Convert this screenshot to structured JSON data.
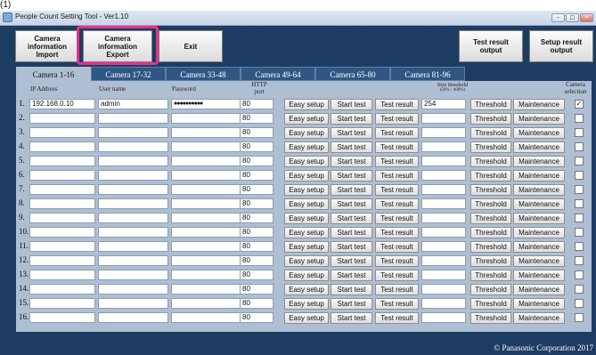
{
  "figure_label": "(1)",
  "window": {
    "title": "People Count Setting Tool - Ver1.10",
    "controls": {
      "minimize": "–",
      "maximize": "□",
      "close": "×"
    }
  },
  "toolbar": {
    "import_label": "Camera\ninformation\nImport",
    "export_label": "Camera\ninformation\nExport",
    "exit_label": "Exit",
    "test_result_output_label": "Test result\noutput",
    "setup_result_output_label": "Setup result\noutput"
  },
  "tabs": [
    "Camera 1-16",
    "Camera 17-32",
    "Camera 33-48",
    "Camera 49-64",
    "Camera 65-80",
    "Camera 81-96"
  ],
  "headers": {
    "ip": "IP Address",
    "user": "User name",
    "password": "Password",
    "http_port": "HTTP\nport",
    "size_threshold": "Size threshold",
    "size_threshold_range": "(50% - 400%)",
    "camera_selection": "Camera\nselection"
  },
  "row_buttons": {
    "easy_setup": "Easy setup",
    "start_test": "Start test",
    "test_result": "Test result",
    "threshold": "Threshold",
    "maintenance": "Maintenance"
  },
  "rows": [
    {
      "num": "1.",
      "ip": "192.168.0.10",
      "user": "admin",
      "password": "●●●●●●●●●●",
      "port": "80",
      "size": "254",
      "checked": "✓"
    },
    {
      "num": "2.",
      "ip": "",
      "user": "",
      "password": "",
      "port": "80",
      "size": "",
      "checked": ""
    },
    {
      "num": "3.",
      "ip": "",
      "user": "",
      "password": "",
      "port": "80",
      "size": "",
      "checked": ""
    },
    {
      "num": "4.",
      "ip": "",
      "user": "",
      "password": "",
      "port": "80",
      "size": "",
      "checked": ""
    },
    {
      "num": "5.",
      "ip": "",
      "user": "",
      "password": "",
      "port": "80",
      "size": "",
      "checked": ""
    },
    {
      "num": "6.",
      "ip": "",
      "user": "",
      "password": "",
      "port": "80",
      "size": "",
      "checked": ""
    },
    {
      "num": "7.",
      "ip": "",
      "user": "",
      "password": "",
      "port": "80",
      "size": "",
      "checked": ""
    },
    {
      "num": "8.",
      "ip": "",
      "user": "",
      "password": "",
      "port": "80",
      "size": "",
      "checked": ""
    },
    {
      "num": "9.",
      "ip": "",
      "user": "",
      "password": "",
      "port": "80",
      "size": "",
      "checked": ""
    },
    {
      "num": "10.",
      "ip": "",
      "user": "",
      "password": "",
      "port": "80",
      "size": "",
      "checked": ""
    },
    {
      "num": "11.",
      "ip": "",
      "user": "",
      "password": "",
      "port": "80",
      "size": "",
      "checked": ""
    },
    {
      "num": "12.",
      "ip": "",
      "user": "",
      "password": "",
      "port": "80",
      "size": "",
      "checked": ""
    },
    {
      "num": "13.",
      "ip": "",
      "user": "",
      "password": "",
      "port": "80",
      "size": "",
      "checked": ""
    },
    {
      "num": "14.",
      "ip": "",
      "user": "",
      "password": "",
      "port": "80",
      "size": "",
      "checked": ""
    },
    {
      "num": "15.",
      "ip": "",
      "user": "",
      "password": "",
      "port": "80",
      "size": "",
      "checked": ""
    },
    {
      "num": "16.",
      "ip": "",
      "user": "",
      "password": "",
      "port": "80",
      "size": "",
      "checked": ""
    }
  ],
  "copyright": "© Panasonic Corporation 2017",
  "colors": {
    "window_bg": "#1d3c62",
    "panel_bg": "#aebfd3",
    "highlight": "#e8308a"
  }
}
